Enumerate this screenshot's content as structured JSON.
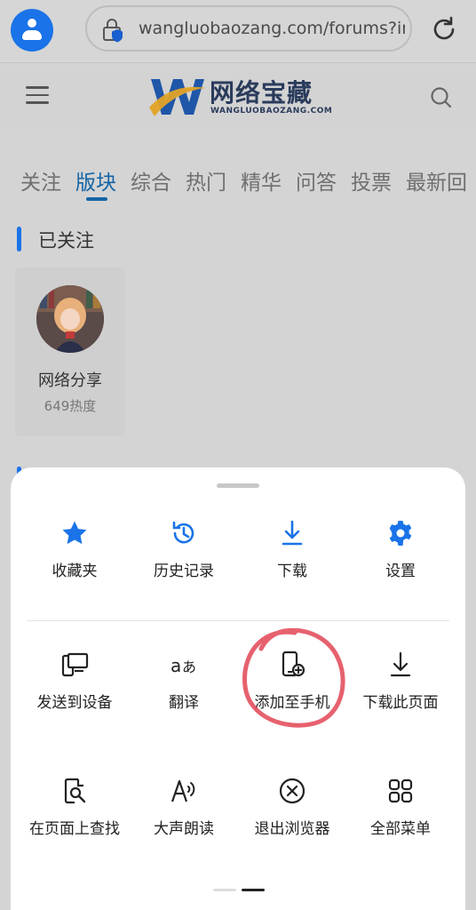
{
  "browser": {
    "url": "wangluobaozang.com/forums?ir"
  },
  "site": {
    "logo_text": "网络宝藏",
    "logo_sub": "WANGLUOBAOZANG.COM"
  },
  "tabs": [
    {
      "label": "关注"
    },
    {
      "label": "版块"
    },
    {
      "label": "综合"
    },
    {
      "label": "热门"
    },
    {
      "label": "精华"
    },
    {
      "label": "问答"
    },
    {
      "label": "投票"
    },
    {
      "label": "最新回"
    }
  ],
  "followed": {
    "title": "已关注",
    "forum": {
      "name": "网络分享",
      "heat": "649热度"
    }
  },
  "menu": {
    "row1": [
      {
        "label": "收藏夹",
        "icon": "star-icon"
      },
      {
        "label": "历史记录",
        "icon": "history-icon"
      },
      {
        "label": "下载",
        "icon": "download-icon"
      },
      {
        "label": "设置",
        "icon": "gear-icon"
      }
    ],
    "row2": [
      {
        "label": "发送到设备",
        "icon": "send-to-device-icon"
      },
      {
        "label": "翻译",
        "icon": "translate-icon"
      },
      {
        "label": "添加至手机",
        "icon": "add-to-phone-icon"
      },
      {
        "label": "下载此页面",
        "icon": "download-page-icon"
      }
    ],
    "row3": [
      {
        "label": "在页面上查找",
        "icon": "find-in-page-icon"
      },
      {
        "label": "大声朗读",
        "icon": "read-aloud-icon"
      },
      {
        "label": "退出浏览器",
        "icon": "exit-icon"
      },
      {
        "label": "全部菜单",
        "icon": "all-menu-icon"
      }
    ]
  },
  "colors": {
    "accent": "#1a73e8",
    "annotation": "#e03a4a"
  }
}
